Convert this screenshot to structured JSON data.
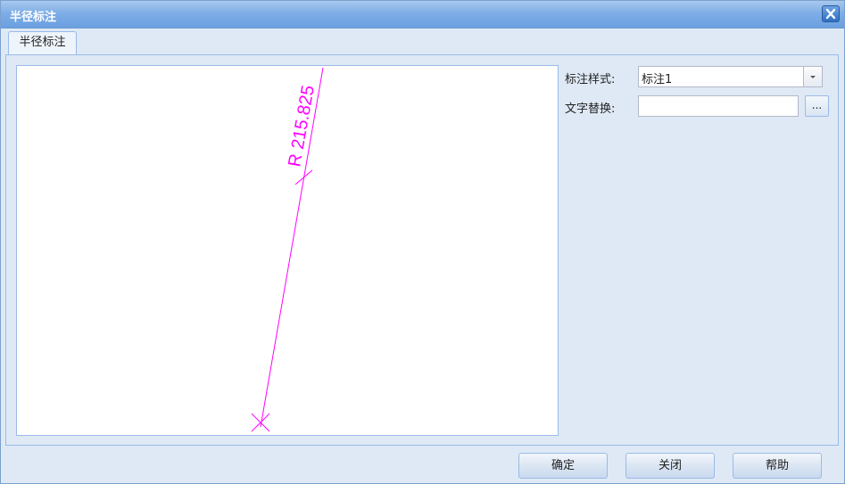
{
  "window": {
    "title": "半径标注"
  },
  "tabs": [
    {
      "label": "半径标注"
    }
  ],
  "preview": {
    "dimension_text": "R 215.825",
    "color": "#ff00ff"
  },
  "form": {
    "style_label": "标注样式:",
    "style_value": "标注1",
    "text_override_label": "文字替换:",
    "text_override_value": "",
    "browse_label": "..."
  },
  "footer": {
    "ok_label": "确定",
    "close_label": "关闭",
    "help_label": "帮助"
  },
  "colors": {
    "accent": "#6b9fe0",
    "dimension": "#ff00ff"
  }
}
